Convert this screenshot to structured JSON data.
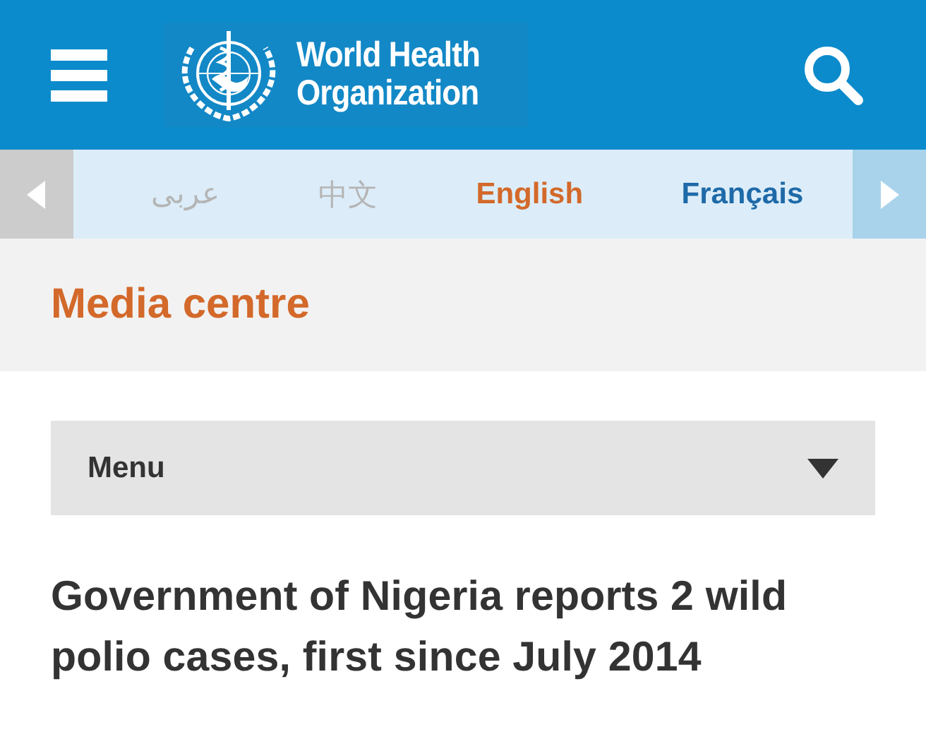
{
  "header": {
    "logo_text": [
      "World Health",
      "Organization"
    ]
  },
  "languages": [
    {
      "label": "عربى",
      "selected": false,
      "disabled": true
    },
    {
      "label": "中文",
      "selected": false,
      "disabled": true
    },
    {
      "label": "English",
      "selected": true,
      "disabled": false
    },
    {
      "label": "Français",
      "selected": false,
      "disabled": false
    }
  ],
  "section_title": "Media centre",
  "menu": {
    "label": "Menu",
    "expanded": false
  },
  "headline": "Government of Nigeria reports 2 wild polio cases, first since July 2014"
}
